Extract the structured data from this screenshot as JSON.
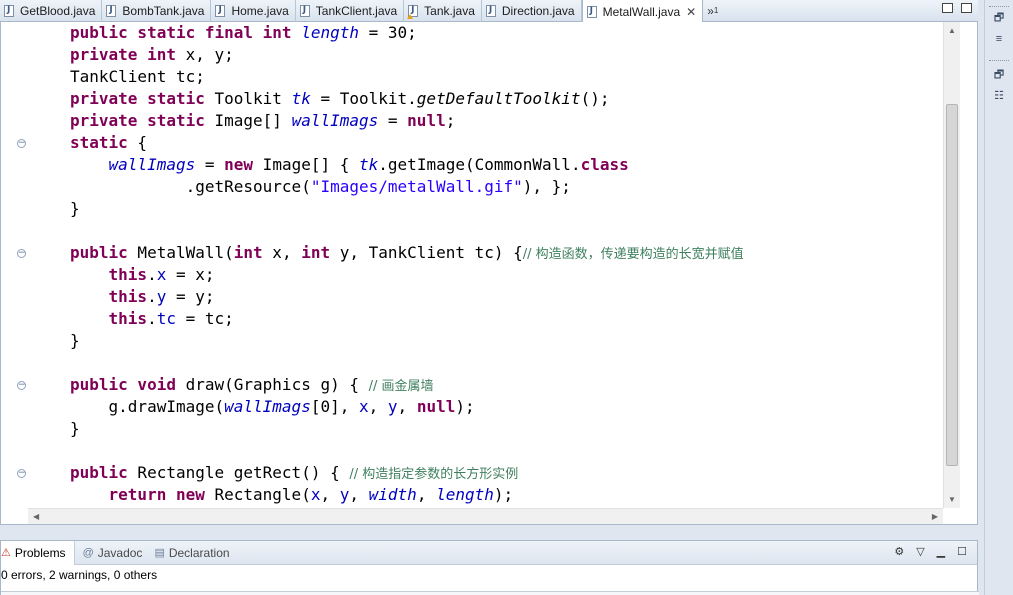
{
  "editor_tabs": [
    {
      "label": "GetBlood.java",
      "active": false,
      "warn": false
    },
    {
      "label": "BombTank.java",
      "active": false,
      "warn": false
    },
    {
      "label": "Home.java",
      "active": false,
      "warn": false
    },
    {
      "label": "TankClient.java",
      "active": false,
      "warn": false
    },
    {
      "label": "Tank.java",
      "active": false,
      "warn": true
    },
    {
      "label": "Direction.java",
      "active": false,
      "warn": false
    },
    {
      "label": "MetalWall.java",
      "active": true,
      "warn": false
    }
  ],
  "tab_close": "✕",
  "overflow": {
    "chevron": "»",
    "count": "1"
  },
  "code": {
    "l1": {
      "kw": "public static final int",
      "name": "length",
      "rest": " = 30;"
    },
    "l2": {
      "kw": "private int",
      "rest": " x, y;"
    },
    "l3": {
      "text": "TankClient tc;"
    },
    "l4": {
      "kw": "private static",
      "type": " Toolkit ",
      "name": "tk",
      "mid": " = Toolkit.",
      "meth": "getDefaultToolkit",
      "rest": "();"
    },
    "l5": {
      "kw": "private static",
      "type": " Image[] ",
      "name": "wallImags",
      "mid": " = ",
      "kw2": "null",
      "rest": ";"
    },
    "l6": {
      "kw": "static",
      "rest": " {"
    },
    "l7": {
      "name": "wallImags",
      "mid": " = ",
      "kw": "new",
      "mid2": " Image[] { ",
      "name2": "tk",
      "mid3": ".getImage(CommonWall.",
      "kw2": "class"
    },
    "l8": {
      "pre": "        .getResource(",
      "str": "\"Images/metalWall.gif\"",
      "rest": "), };"
    },
    "l9": {
      "text": "}"
    },
    "l10": {
      "kw": "public",
      "mid": " MetalWall(",
      "kw2": "int",
      "mid2": " x, ",
      "kw3": "int",
      "mid3": " y, TankClient tc) {",
      "cmt": "// 构造函数，传递要构造的长宽并赋值"
    },
    "l11": {
      "kw": "this",
      "dot": ".",
      "fld": "x",
      "rest": " = x;"
    },
    "l12": {
      "kw": "this",
      "dot": ".",
      "fld": "y",
      "rest": " = y;"
    },
    "l13": {
      "kw": "this",
      "dot": ".",
      "fld": "tc",
      "rest": " = tc;"
    },
    "l14": {
      "text": "}"
    },
    "l15": {
      "kw": "public void",
      "mid": " draw(Graphics g) { ",
      "cmt": "// 画金属墙"
    },
    "l16": {
      "pre": "g.drawImage(",
      "name": "wallImags",
      "mid": "[0], ",
      "fld1": "x",
      "sep": ", ",
      "fld2": "y",
      "sep2": ", ",
      "kw": "null",
      "rest": ");"
    },
    "l17": {
      "text": "}"
    },
    "l18": {
      "kw": "public",
      "mid": " Rectangle getRect() { ",
      "cmt": "// 构造指定参数的长方形实例"
    },
    "l19": {
      "kw": "return new",
      "mid": " Rectangle(",
      "fld1": "x",
      "sep": ", ",
      "fld2": "y",
      "sep2": ", ",
      "name1": "width",
      "sep3": ", ",
      "name2": "length",
      "rest": ");"
    }
  },
  "panel": {
    "tabs": [
      {
        "label": "Problems",
        "icon": "⚠",
        "active": true
      },
      {
        "label": "Javadoc",
        "icon": "@",
        "active": false
      },
      {
        "label": "Declaration",
        "icon": "▤",
        "active": false
      }
    ],
    "status": "0 errors, 2 warnings, 0 others"
  },
  "icons": {
    "restore": "🗗",
    "minimize": "▁",
    "maximize": "☐",
    "menu": "▽",
    "fold": "−",
    "scroll_up": "▲",
    "scroll_down": "▼",
    "scroll_left": "◀",
    "scroll_right": "▶"
  }
}
